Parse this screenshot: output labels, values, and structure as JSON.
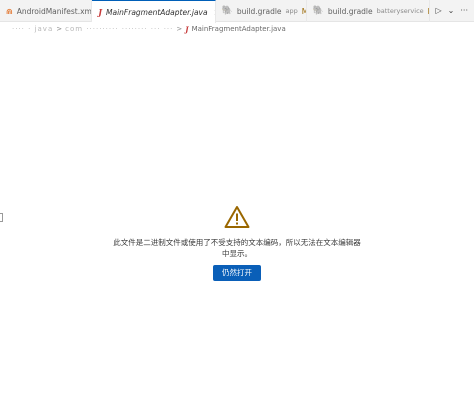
{
  "tabs": [
    {
      "icon": "xml-file-icon",
      "label": "AndroidManifest.xml",
      "active": false
    },
    {
      "icon": "java-file-icon",
      "label": "MainFragmentAdapter.java",
      "active": true,
      "close": "×"
    },
    {
      "icon": "gradle-file-icon",
      "label": "build.gradle",
      "desc": "app",
      "modified": "M"
    },
    {
      "icon": "gradle-file-icon",
      "label": "build.gradle",
      "desc": "batteryservice",
      "modified": "M"
    }
  ],
  "tab_actions": {
    "run": "▷",
    "run_dropdown": "⌄",
    "more": "···"
  },
  "breadcrumb": {
    "segments_blurred": [
      "···· · java",
      "com ·········· ········ ··· ···"
    ],
    "separator": ">",
    "file": "MainFragmentAdapter.java"
  },
  "message": "此文件是二进制文件或使用了不受支持的文本编码，所以无法在文本编辑器中显示。",
  "open_button": "仍然打开",
  "colors": {
    "accent": "#005fb8",
    "warning": "#9a6700",
    "button": "#0a5fb8"
  }
}
